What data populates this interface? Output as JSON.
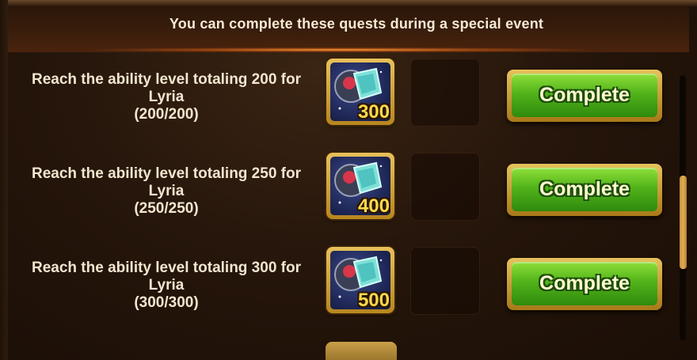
{
  "header": {
    "title": "You can complete these quests during a special event"
  },
  "quests": [
    {
      "description_line1": "Reach the ability level totaling 200 for",
      "description_line2": "Lyria",
      "progress": "(200/200)",
      "reward_amount": "300",
      "button_label": "Complete"
    },
    {
      "description_line1": "Reach the ability level totaling 250 for",
      "description_line2": "Lyria",
      "progress": "(250/250)",
      "reward_amount": "400",
      "button_label": "Complete"
    },
    {
      "description_line1": "Reach the ability level totaling 300 for",
      "description_line2": "Lyria",
      "progress": "(300/300)",
      "reward_amount": "500",
      "button_label": "Complete"
    }
  ],
  "reward_icon": "ability-crystal-icon",
  "colors": {
    "button_green": "#52b31a",
    "gold_frame": "#e8c15a",
    "reward_amount": "#ffd94a",
    "text": "#f2e6cf"
  }
}
